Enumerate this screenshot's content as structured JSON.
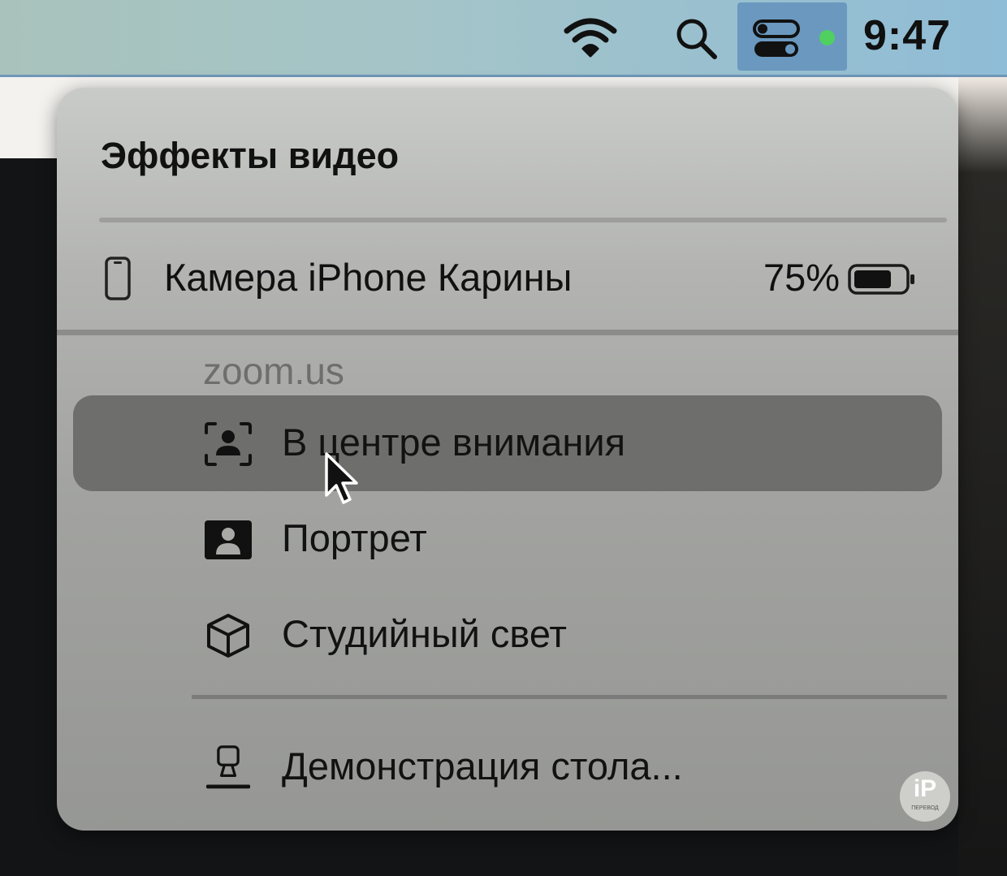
{
  "menubar": {
    "clock": "9:47",
    "icons": [
      "wifi-icon",
      "search-icon",
      "control-center-icon",
      "camera-in-use-indicator"
    ],
    "indicator_color": "#4fd061"
  },
  "panel": {
    "title": "Эффекты видео",
    "device": {
      "name": "Камера iPhone Карины",
      "battery": "75%",
      "battery_level": 0.75,
      "icon": "iphone-icon"
    },
    "app_label": "zoom.us",
    "items": [
      {
        "label": "В центре внимания",
        "icon": "center-stage-icon",
        "selected": true
      },
      {
        "label": "Портрет",
        "icon": "portrait-icon",
        "selected": false
      },
      {
        "label": "Студийный свет",
        "icon": "studio-light-icon",
        "selected": false
      }
    ],
    "desk_view": {
      "label": "Демонстрация стола...",
      "icon": "desk-view-icon"
    }
  },
  "watermark": {
    "main": "iP",
    "sub": "ПЕРЕВОД"
  }
}
